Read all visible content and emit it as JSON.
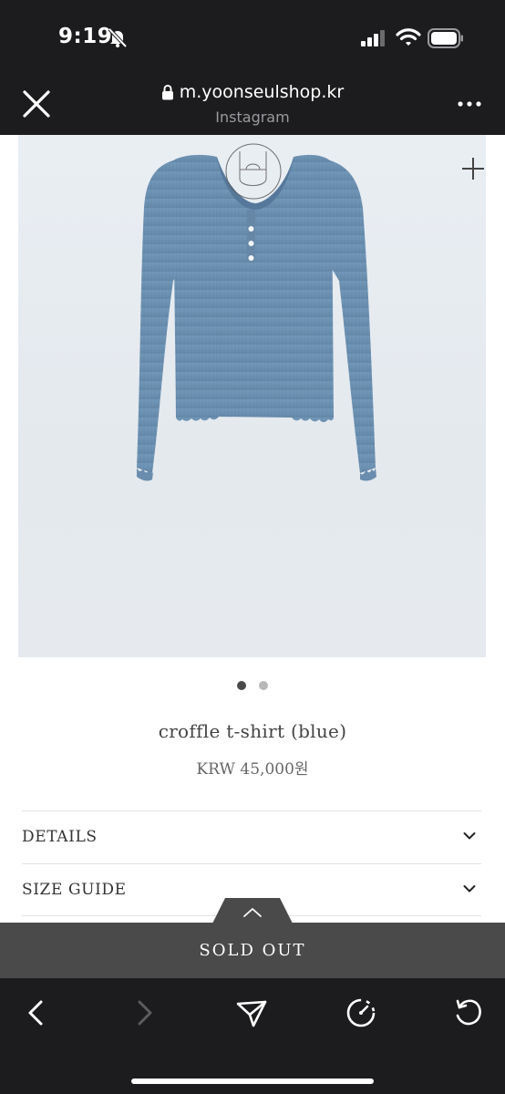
{
  "status_bar": {
    "time": "9:19",
    "icons": [
      "bell-off-icon",
      "signal-icon",
      "wifi-icon",
      "battery-icon"
    ]
  },
  "browser": {
    "url": "m.yoonseulshop.kr",
    "source": "Instagram",
    "icons": [
      "close-icon",
      "lock-icon",
      "more-icon"
    ]
  },
  "product": {
    "name": "croffle t-shirt (blue)",
    "price": "KRW 45,000원",
    "image_description": "blue ribbed long-sleeve henley top",
    "colors": {
      "shirt": "#6e93b3",
      "background": "#e6ebf0"
    },
    "carousel": {
      "current": 1,
      "total": 2
    }
  },
  "accordion": [
    {
      "label": "DETAILS"
    },
    {
      "label": "SIZE GUIDE"
    }
  ],
  "sold_out": {
    "label": "SOLD OUT"
  },
  "toolbar": {
    "icons": [
      "back-icon",
      "forward-icon",
      "share-icon",
      "speed-icon",
      "reload-icon"
    ],
    "forward_enabled": false
  },
  "colors": {
    "chrome": "#1c1c1e",
    "sold_bar": "#4a4a4a"
  }
}
